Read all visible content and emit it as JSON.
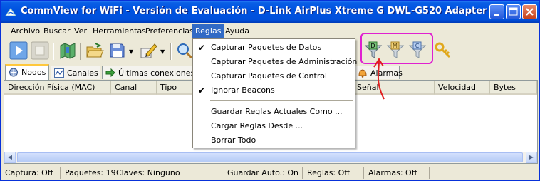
{
  "window": {
    "title": "CommView for WiFi - Versión de Evaluación - D-Link AirPlus Xtreme G DWL-G520 Adapter",
    "icon": "commview-app-icon"
  },
  "menubar": {
    "items": [
      "Archivo",
      "Buscar",
      "Ver",
      "Herramientas",
      "Preferencias",
      "Reglas",
      "Ayuda"
    ],
    "active": "Reglas"
  },
  "reglas_menu": {
    "items": [
      {
        "label": "Capturar Paquetes de Datos",
        "checked": true
      },
      {
        "label": "Capturar Paquetes de Administración",
        "checked": false
      },
      {
        "label": "Capturar Paquetes de Control",
        "checked": false
      },
      {
        "label": "Ignorar Beacons",
        "checked": true
      },
      {
        "label": "Guardar Reglas Actuales Como ...",
        "checked": false
      },
      {
        "label": "Cargar Reglas Desde ...",
        "checked": false
      },
      {
        "label": "Borrar Todo",
        "checked": false
      }
    ]
  },
  "toolbar": {
    "icons": [
      "play-icon",
      "stop-icon",
      "map-icon",
      "open-folder-icon",
      "save-icon",
      "dropdown-arrow-icon",
      "edit-icon",
      "dropdown-arrow-icon",
      "search-icon",
      "data-filter-icon",
      "management-filter-icon",
      "control-filter-icon",
      "key-icon"
    ],
    "filter_letters": {
      "data": "D",
      "management": "M",
      "control": "C"
    }
  },
  "tabs": [
    {
      "label": "Nodos",
      "icon": "nodes-icon",
      "selected": true
    },
    {
      "label": "Canales",
      "icon": "channels-icon",
      "selected": false
    },
    {
      "label": "Últimas conexiones IP",
      "icon": "connections-icon",
      "selected": false
    },
    {
      "label": "Alarmas",
      "icon": "alarm-icon",
      "selected": false
    }
  ],
  "table": {
    "columns": [
      "Dirección Física (MAC)",
      "Canal",
      "Tipo",
      "Señal",
      "Velocidad",
      "Bytes"
    ]
  },
  "statusbar": {
    "captura": "Captura: Off",
    "paquetes": "Paquetes: 19",
    "claves": "Claves: Ninguno",
    "guardar": "Guardar Auto.: On",
    "reglas": "Reglas: Off",
    "alarmas": "Alarmas: Off"
  },
  "colors": {
    "titlebar": "#0053e0",
    "menu_highlight": "#316ac5",
    "annotation": "#e020d0"
  }
}
